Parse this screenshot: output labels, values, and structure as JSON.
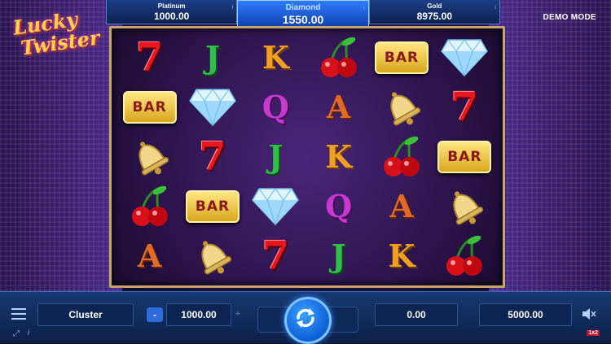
{
  "game": {
    "logo_line1": "Lucky",
    "logo_line2": "Twister",
    "demo_label": "DEMO MODE"
  },
  "jackpots": [
    {
      "name": "Platinum",
      "value": "1000.00",
      "active": false
    },
    {
      "name": "Diamond",
      "value": "1550.00",
      "active": true
    },
    {
      "name": "Gold",
      "value": "8975.00",
      "active": false
    }
  ],
  "reels": [
    [
      "7",
      "J",
      "K",
      "cherry",
      "BAR",
      "diamond"
    ],
    [
      "BAR",
      "diamond",
      "Q",
      "A",
      "bell",
      "7"
    ],
    [
      "bell",
      "7",
      "J",
      "K",
      "cherry",
      "BAR"
    ],
    [
      "cherry",
      "BAR",
      "diamond",
      "Q",
      "A",
      "bell"
    ],
    [
      "A",
      "bell",
      "7",
      "J",
      "K",
      "cherry"
    ]
  ],
  "controls": {
    "mode_label": "Cluster",
    "minus_label": "-",
    "plus_label": "+",
    "bet_value": "1000.00",
    "win_value": "0.00",
    "balance_value": "5000.00",
    "brand_text": "1x2"
  },
  "icons": {
    "menu": "menu-icon",
    "spin": "spin-icon",
    "sound": "sound-icon",
    "fullscreen": "fullscreen-icon",
    "info": "info-icon"
  },
  "colors": {
    "accent": "#2f8cff",
    "panel": "#0e2553",
    "frame": "#c6a56a"
  }
}
